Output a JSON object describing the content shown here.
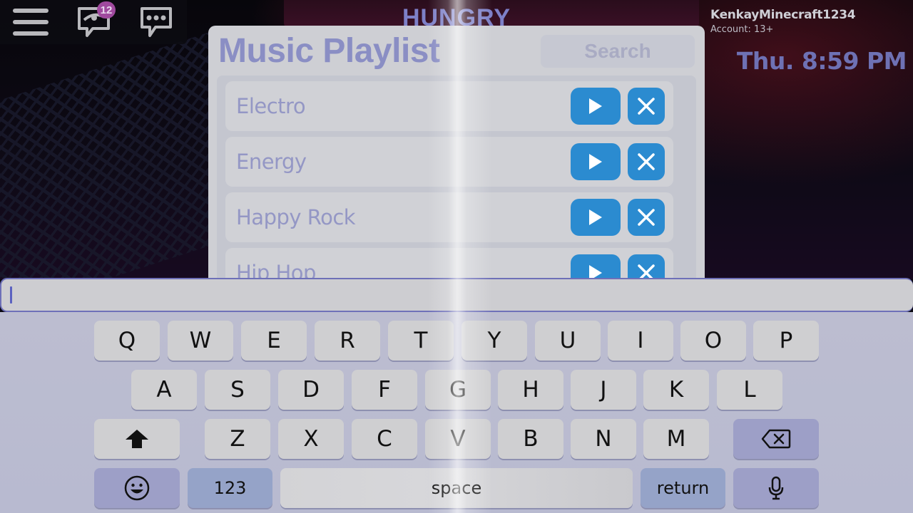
{
  "game": {
    "status_banner": "HUNGRY"
  },
  "hud": {
    "menu_icon": "hamburger-menu-icon",
    "chat_icon": "chat-eye-icon",
    "chat_badge_count": "12",
    "more_icon": "chat-ellipsis-icon",
    "username": "KenkayMinecraft1234",
    "account_label": "Account: 13+",
    "clock": "Thu. 8:59 PM"
  },
  "playlist": {
    "title": "Music Playlist",
    "search_placeholder": "Search",
    "songs": [
      {
        "name": "Electro"
      },
      {
        "name": "Energy"
      },
      {
        "name": "Happy Rock"
      },
      {
        "name": "Hip Hop"
      }
    ],
    "play_icon": "play-icon",
    "delete_icon": "close-icon"
  },
  "text_input": {
    "value": "",
    "placeholder": ""
  },
  "keyboard": {
    "row1": [
      "Q",
      "W",
      "E",
      "R",
      "T",
      "Y",
      "U",
      "I",
      "O",
      "P"
    ],
    "row2": [
      "A",
      "S",
      "D",
      "F",
      "G",
      "H",
      "J",
      "K",
      "L"
    ],
    "row3": [
      "Z",
      "X",
      "C",
      "V",
      "B",
      "N",
      "M"
    ],
    "shift_icon": "shift-arrow-icon",
    "backspace_icon": "backspace-icon",
    "emoji_icon": "emoji-icon",
    "numbers_label": "123",
    "space_label": "space",
    "return_label": "return",
    "mic_icon": "microphone-icon"
  },
  "colors": {
    "accent_blue": "#2b8bd0",
    "title_lavender": "#8a8ec4",
    "badge_purple": "#a04a9e"
  }
}
